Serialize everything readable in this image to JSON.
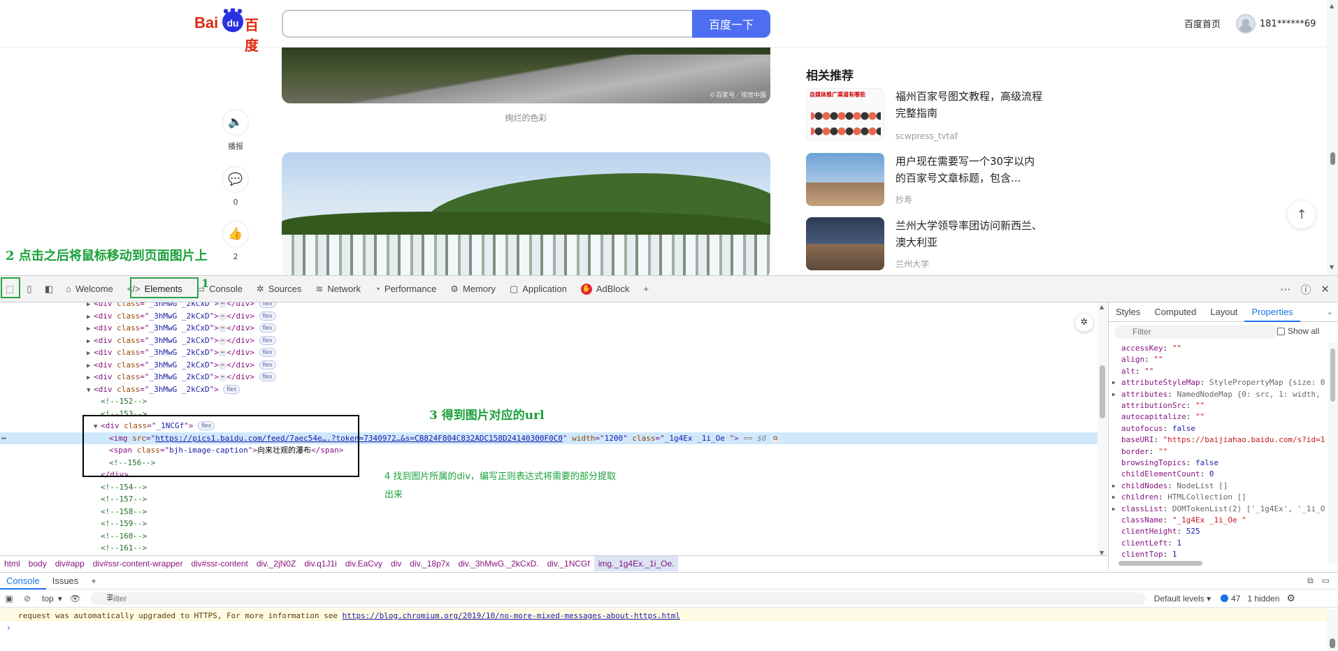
{
  "header": {
    "logo_text_left": "Bai",
    "logo_text_paw": "du",
    "logo_text_right": "百度",
    "search_placeholder": "",
    "search_button": "百度一下",
    "home_link": "百度首页",
    "username": "181******69"
  },
  "article": {
    "image1_credit": "©百家号／视觉中国",
    "image1_caption": "绚烂的色彩"
  },
  "side_actions": [
    {
      "icon": "speaker-icon",
      "glyph": "🔈",
      "label": "播报"
    },
    {
      "icon": "comment-icon",
      "glyph": "💬",
      "label": "0"
    },
    {
      "icon": "thumbs-up-icon",
      "glyph": "👍",
      "label": "2"
    }
  ],
  "related": {
    "title": "相关推荐",
    "items": [
      {
        "title": "福州百家号图文教程，高级流程完整指南",
        "source": "scwpress_tvtaf",
        "thumb_heading": "自媒体推广渠道有哪些"
      },
      {
        "title": "用户现在需要写一个30字以内的百家号文章标题，包含...",
        "source": "抄寿"
      },
      {
        "title": "兰州大学领导率团访问新西兰、澳大利亚",
        "source": "兰州大学"
      }
    ]
  },
  "annotations": {
    "step1": "1",
    "step2": "2 点击之后将鼠标移动到页面图片上",
    "step3": "3 得到图片对应的url",
    "step4": "4 找到图片所属的div，编写正则表达式将需要的部分提取出来"
  },
  "devtools": {
    "tabs": [
      {
        "label": "Welcome",
        "icon": "home-icon",
        "glyph": "⌂"
      },
      {
        "label": "Elements",
        "icon": "code-icon",
        "glyph": "</>",
        "active": true
      },
      {
        "label": "Console",
        "icon": "console-icon",
        "glyph": "▭"
      },
      {
        "label": "Sources",
        "icon": "bug-icon",
        "glyph": "✲"
      },
      {
        "label": "Network",
        "icon": "wifi-icon",
        "glyph": "≋"
      },
      {
        "label": "Performance",
        "icon": "gauge-icon",
        "glyph": "◔"
      },
      {
        "label": "Memory",
        "icon": "chip-icon",
        "glyph": "⚙"
      },
      {
        "label": "Application",
        "icon": "app-icon",
        "glyph": "▢"
      },
      {
        "label": "AdBlock",
        "icon": "adblock-icon",
        "glyph": "✋"
      }
    ],
    "dom": {
      "collapsed_class": "_3hMwG _2kCxD",
      "flex_badge": "flex",
      "comments": [
        "<!--152-->",
        "<!--153-->",
        "<!--156-->",
        "<!--154-->",
        "<!--157-->",
        "<!--158-->",
        "<!--159-->",
        "<!--160-->",
        "<!--161-->"
      ],
      "wrapper_class": "_1NCGf",
      "img_src": "https://pics1.baidu.com/feed/7aec54e….?token=7340972…&s=CB824F804C832ADC158D24140300F0C0",
      "img_width": "1200",
      "img_class": "_1g4Ex _1i_Oe ",
      "eq0": "== $0",
      "span_class": "bjh-image-caption",
      "span_text": "向来壮观的瀑布"
    },
    "breadcrumbs": [
      "html",
      "body",
      "div#app",
      "div#ssr-content-wrapper",
      "div#ssr-content",
      "div._2jN0Z",
      "div.q1J1i",
      "div.EaCvy",
      "div",
      "div._18p7x",
      "div._3hMwG._2kCxD.",
      "div._1NCGf",
      "img._1g4Ex._1i_Oe."
    ],
    "props_tabs": [
      "Styles",
      "Computed",
      "Layout",
      "Properties"
    ],
    "props_filter_placeholder": "Filter",
    "show_all": "Show all",
    "properties": [
      {
        "k": "accessKey",
        "v": "\"\"",
        "t": "str"
      },
      {
        "k": "align",
        "v": "\"\"",
        "t": "str"
      },
      {
        "k": "alt",
        "v": "\"\"",
        "t": "str"
      },
      {
        "k": "attributeStyleMap",
        "v": "StylePropertyMap {size: 0",
        "t": "obj",
        "exp": true
      },
      {
        "k": "attributes",
        "v": "NamedNodeMap {0: src, 1: width,",
        "t": "obj",
        "exp": true
      },
      {
        "k": "attributionSrc",
        "v": "\"\"",
        "t": "str"
      },
      {
        "k": "autocapitalize",
        "v": "\"\"",
        "t": "str"
      },
      {
        "k": "autofocus",
        "v": "false",
        "t": "num"
      },
      {
        "k": "baseURI",
        "v": "\"https://baijiahao.baidu.com/s?id=1",
        "t": "str"
      },
      {
        "k": "border",
        "v": "\"\"",
        "t": "str"
      },
      {
        "k": "browsingTopics",
        "v": "false",
        "t": "num"
      },
      {
        "k": "childElementCount",
        "v": "0",
        "t": "num"
      },
      {
        "k": "childNodes",
        "v": "NodeList []",
        "t": "obj",
        "exp": true
      },
      {
        "k": "children",
        "v": "HTMLCollection []",
        "t": "obj",
        "exp": true
      },
      {
        "k": "classList",
        "v": "DOMTokenList(2) ['_1g4Ex', '_1i_O",
        "t": "obj",
        "exp": true
      },
      {
        "k": "className",
        "v": "\"_1g4Ex _1i_Oe \"",
        "t": "str"
      },
      {
        "k": "clientHeight",
        "v": "525",
        "t": "num"
      },
      {
        "k": "clientLeft",
        "v": "1",
        "t": "num"
      },
      {
        "k": "clientTop",
        "v": "1",
        "t": "num"
      }
    ],
    "drawer": {
      "tabs": [
        "Console",
        "Issues"
      ],
      "context": "top",
      "filter_placeholder": "Filter",
      "levels": "Default levels",
      "issues_count": "47",
      "hidden": "1 hidden",
      "message": "request was automatically upgraded to HTTPS, For more information see ",
      "message_link": "https://blog.chromium.org/2019/10/no-more-mixed-messages-about-https.html"
    }
  }
}
